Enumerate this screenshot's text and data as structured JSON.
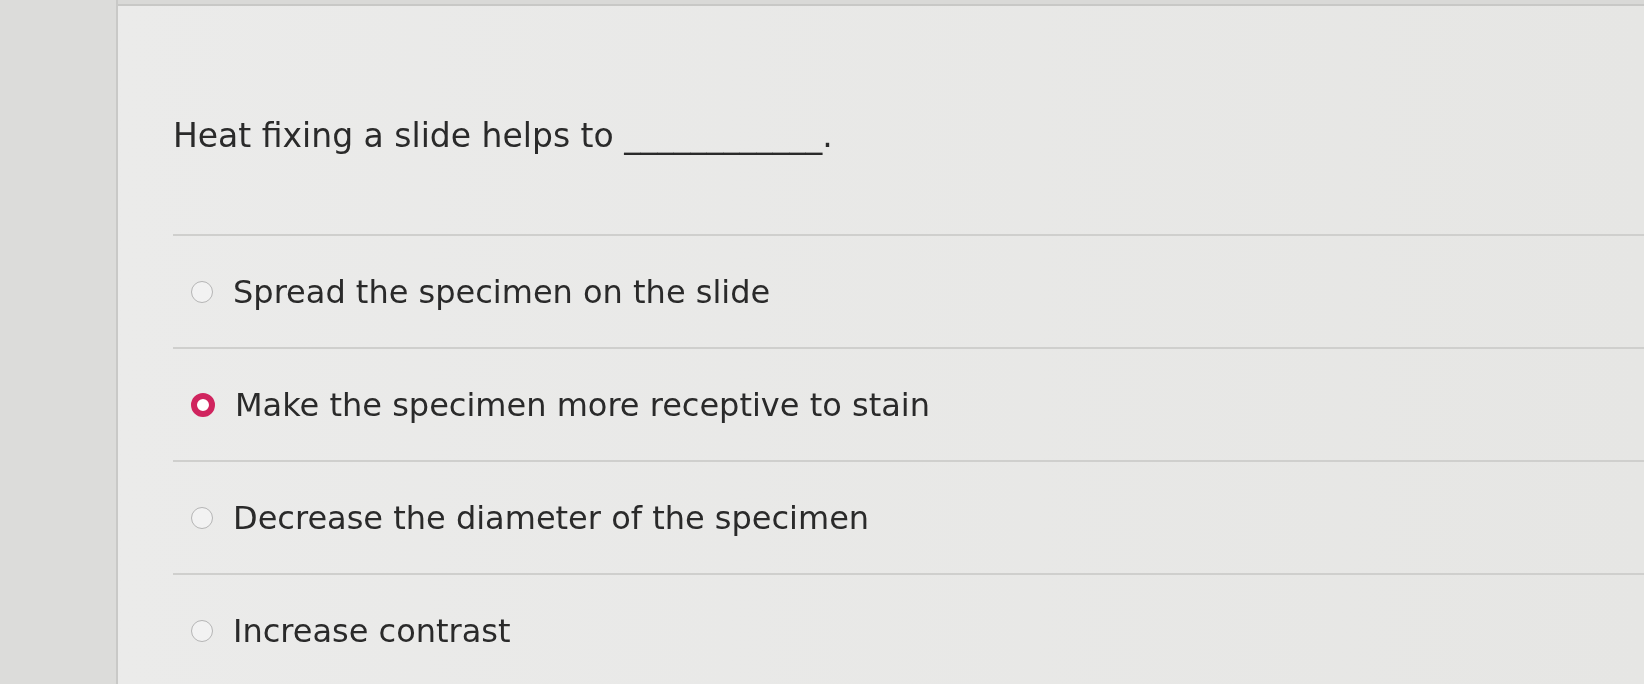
{
  "question": "Heat fixing a slide helps to ____________.",
  "options": [
    {
      "label": "Spread the specimen on the slide",
      "selected": false
    },
    {
      "label": "Make the specimen more receptive to stain",
      "selected": true
    },
    {
      "label": "Decrease the diameter of the specimen",
      "selected": false
    },
    {
      "label": "Increase contrast",
      "selected": false
    }
  ]
}
